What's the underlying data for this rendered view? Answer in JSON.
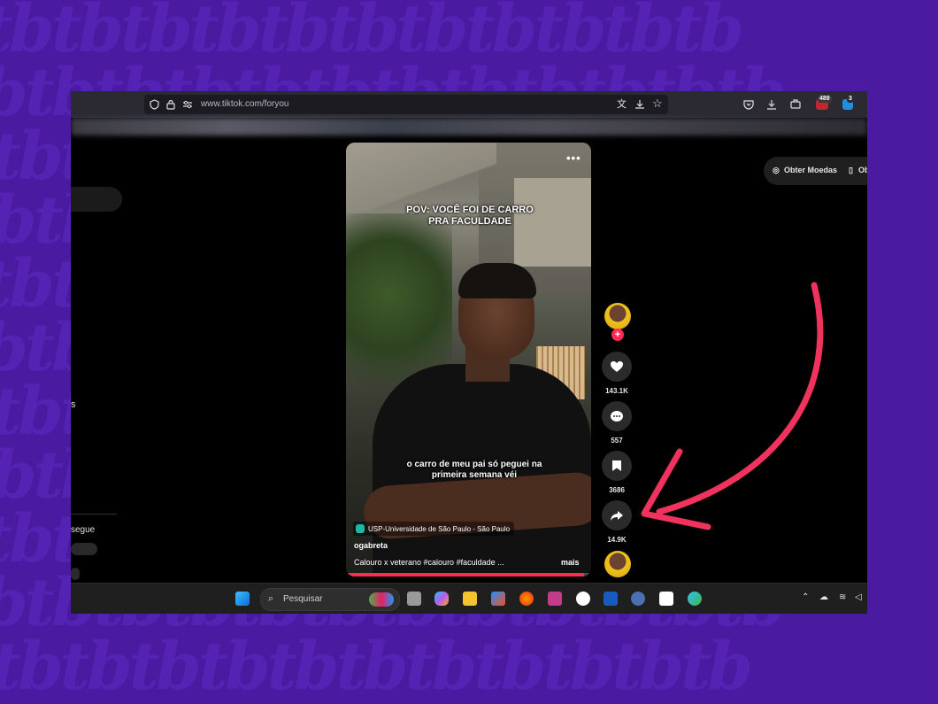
{
  "browser": {
    "url": "www.tiktok.com/foryou",
    "badges": {
      "extension_count": "489",
      "notif_count": "3"
    },
    "icons": [
      "shield-icon",
      "lock-icon",
      "permissions-icon",
      "translate-icon",
      "save-page-icon",
      "bookmark-star-icon",
      "pocket-icon",
      "download-icon",
      "extensions-icon"
    ]
  },
  "sidebar": {
    "partial_label_1": "s",
    "partial_label_2": "segue"
  },
  "top_actions": {
    "coins_label": "Obter Moedas",
    "app_label_partial": "Ob"
  },
  "video": {
    "overlay_top": "POV: VOCÊ FOI DE CARRO PRA FACULDADE",
    "overlay_middle": "o carro de meu pai só peguei na primeira semana véi",
    "location": "USP-Universidade de São Paulo - São Paulo",
    "author": "ogabreta",
    "caption": "Calouro x veterano #calouro #faculdade ...",
    "more_label": "mais",
    "progress": 0.97,
    "more_options_icon": "more-dots-icon"
  },
  "actions": {
    "likes": "143.1K",
    "comments": "557",
    "saves": "3686",
    "shares": "14.9K"
  },
  "taskbar": {
    "search_placeholder": "Pesquisar",
    "apps": [
      "windows-start-icon",
      "task-view-icon",
      "copilot-icon",
      "file-explorer-icon",
      "store-icon",
      "firefox-icon",
      "app-icon",
      "itunes-icon",
      "word-icon",
      "app-icon",
      "app-icon",
      "edge-icon"
    ],
    "tray_icons": [
      "chevron-up-icon",
      "cloud-icon",
      "wifi-icon",
      "volume-icon"
    ]
  },
  "colors": {
    "background": "#4a1aa0",
    "tiktok_red": "#fe2c55",
    "arrow": "#f0335d"
  }
}
